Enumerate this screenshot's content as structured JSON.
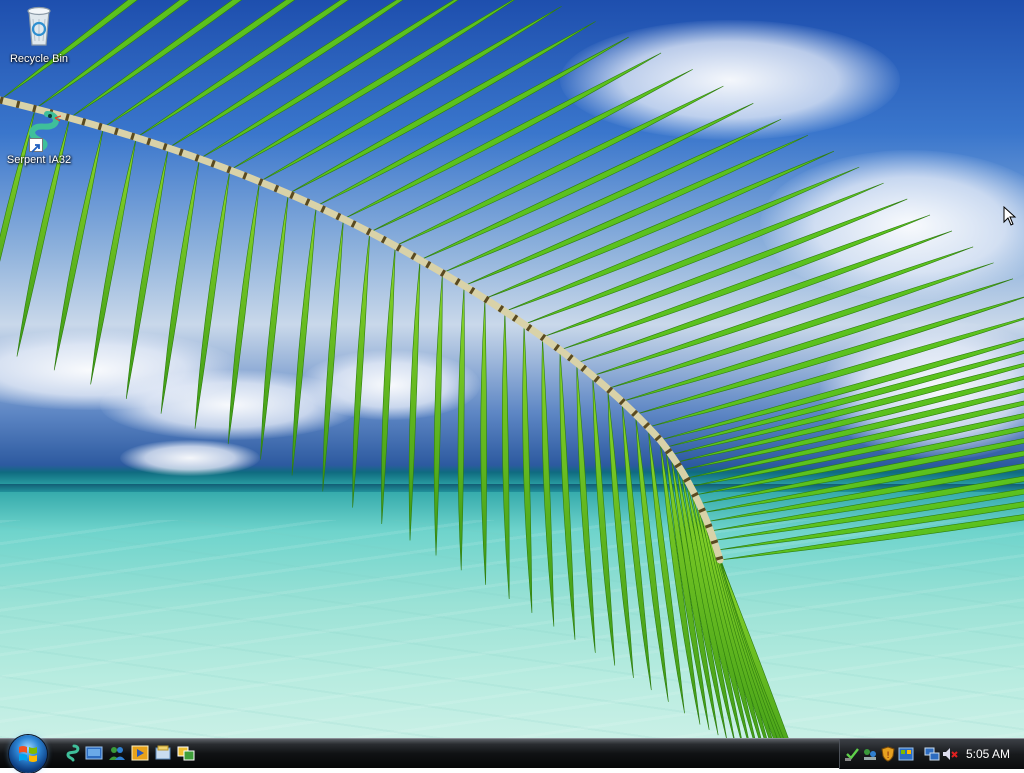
{
  "desktop": {
    "icons": [
      {
        "label": "Recycle Bin",
        "icon": "recycle-bin-icon"
      },
      {
        "label": "Serpent IA32",
        "icon": "serpent-icon"
      }
    ]
  },
  "taskbar": {
    "start_button": "start-orb-icon",
    "quick_launch": [
      "serpent-icon",
      "show-desktop-icon",
      "network-users-icon",
      "media-player-icon",
      "explorer-icon",
      "switch-windows-icon"
    ],
    "tray_icons": [
      "security-icon",
      "network-icon",
      "shield-icon",
      "windows-defender-icon",
      "network-status-icon",
      "volume-muted-icon"
    ],
    "clock": "5:05 AM"
  },
  "colors": {
    "taskbar": "#101214",
    "sky": "#3a76cc",
    "sea": "#9be2d6",
    "palm": "#5cc21e"
  }
}
